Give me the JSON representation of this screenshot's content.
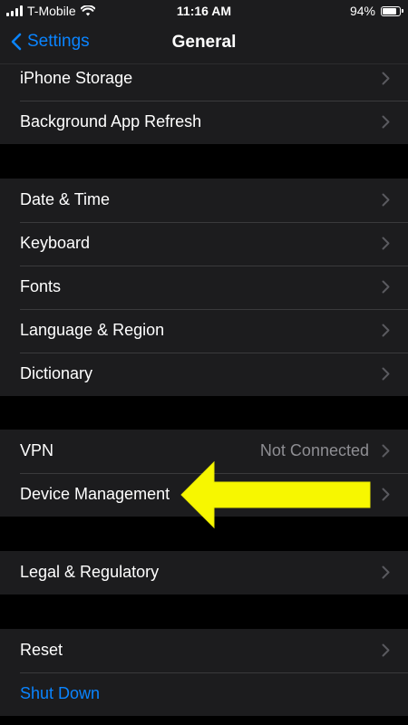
{
  "status_bar": {
    "carrier": "T-Mobile",
    "time": "11:16 AM",
    "battery": "94%",
    "battery_level": 0.94
  },
  "nav": {
    "back_label": "Settings",
    "title": "General"
  },
  "groups": [
    {
      "items": [
        {
          "label": "iPhone Storage"
        },
        {
          "label": "Background App Refresh"
        }
      ]
    },
    {
      "items": [
        {
          "label": "Date & Time"
        },
        {
          "label": "Keyboard"
        },
        {
          "label": "Fonts"
        },
        {
          "label": "Language & Region"
        },
        {
          "label": "Dictionary"
        }
      ]
    },
    {
      "items": [
        {
          "label": "VPN",
          "value": "Not Connected"
        },
        {
          "label": "Device Management"
        }
      ]
    },
    {
      "items": [
        {
          "label": "Legal & Regulatory"
        }
      ]
    },
    {
      "items": [
        {
          "label": "Reset"
        },
        {
          "label": "Shut Down"
        }
      ]
    }
  ],
  "colors": {
    "accent": "#0a84ff",
    "annotation_arrow": "#f7f700"
  },
  "icons": {
    "back": "chevron-left-icon",
    "row": "chevron-right-icon",
    "wifi": "wifi-icon",
    "signal": "signal-icon",
    "battery": "battery-icon"
  }
}
